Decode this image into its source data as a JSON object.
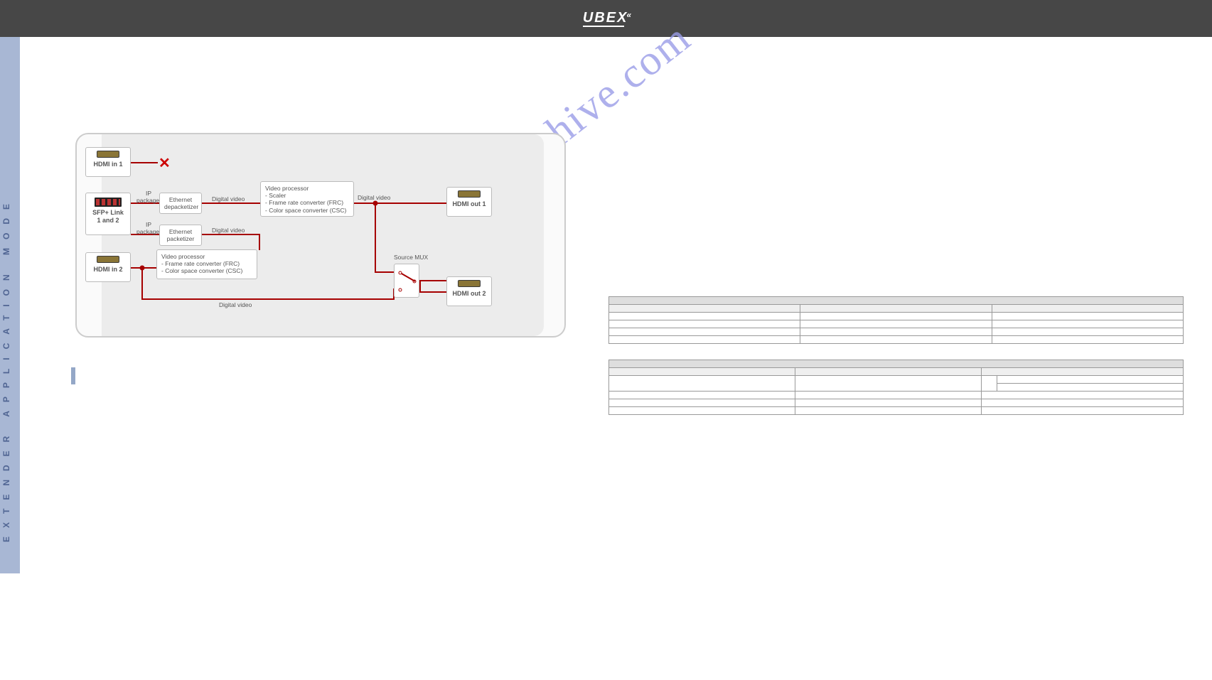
{
  "header": {
    "logo_text": "UBEX"
  },
  "sidebar_label": "EXTENDER APPLICATION MODE",
  "watermark": "manualshive.com",
  "diagram": {
    "hdmi_in1": "HDMI in 1",
    "hdmi_in2": "HDMI in 2",
    "sfp": "SFP+ Link 1 and 2",
    "eth_depack": "Ethernet depacketizer",
    "eth_pack": "Ethernet packetizer",
    "vp1_title": "Video processor",
    "vp1_l1": "- Scaler",
    "vp1_l2": "- Frame rate converter (FRC)",
    "vp1_l3": "- Color space converter (CSC)",
    "vp2_title": "Video processor",
    "vp2_l1": "- Frame rate converter (FRC)",
    "vp2_l2": "- Color space converter (CSC)",
    "hdmi_out1": "HDMI out 1",
    "hdmi_out2": "HDMI out 2",
    "ip_packages": "IP packages",
    "digital_video": "Digital video",
    "source_mux": "Source MUX"
  },
  "note_text": "",
  "table1": {
    "head_row": [
      "",
      "",
      ""
    ],
    "rows": [
      [
        "",
        "",
        ""
      ],
      [
        "",
        "",
        ""
      ],
      [
        "",
        "",
        ""
      ],
      [
        "",
        "",
        ""
      ],
      [
        "",
        "",
        ""
      ]
    ]
  },
  "table2": {
    "head_row": [
      "",
      "",
      ""
    ],
    "subhead": [
      "",
      "",
      ""
    ],
    "rows": [
      [
        "",
        "",
        "",
        ""
      ],
      [
        "",
        "",
        "",
        ""
      ],
      [
        "",
        "",
        ""
      ],
      [
        "",
        "",
        ""
      ],
      [
        "",
        "",
        ""
      ]
    ]
  }
}
